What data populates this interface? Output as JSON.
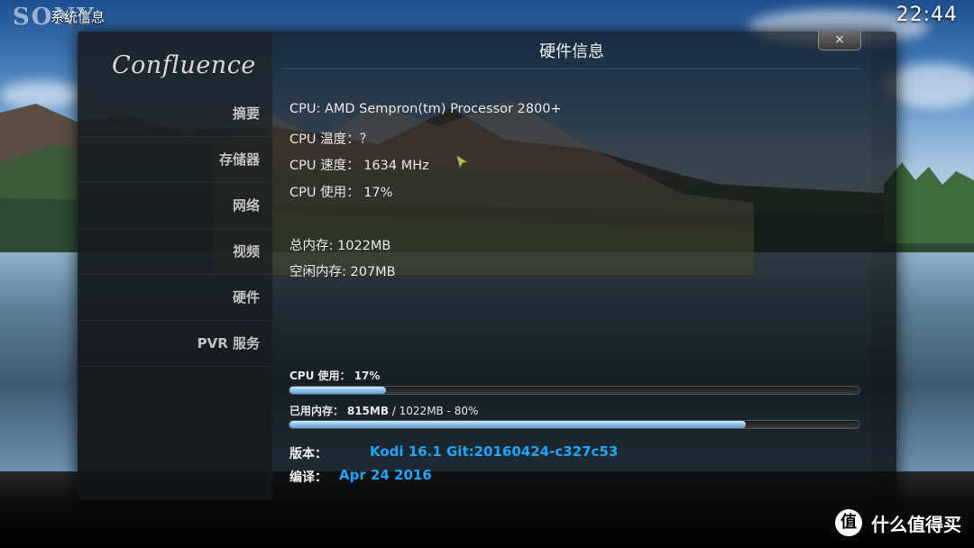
{
  "top": {
    "brand_logo": "SONY",
    "title": "系统信息",
    "clock": "22:44"
  },
  "dialog": {
    "title": "硬件信息",
    "close_label": "×",
    "logo_text": "Confluence"
  },
  "sidebar": {
    "items": [
      {
        "label": "摘要"
      },
      {
        "label": "存储器"
      },
      {
        "label": "网络"
      },
      {
        "label": "视频"
      },
      {
        "label": "硬件"
      },
      {
        "label": "PVR 服务"
      }
    ]
  },
  "info": {
    "cpu_model": "CPU: AMD Sempron(tm) Processor 2800+",
    "cpu_temp": "CPU 温度：？",
    "cpu_speed": "CPU 速度： 1634 MHz",
    "cpu_usage": "CPU 使用： 17%",
    "mem_total": "总内存: 1022MB",
    "mem_free": "空闲内存: 207MB"
  },
  "bars": {
    "cpu": {
      "label": "CPU 使用： 17%",
      "percent": 17
    },
    "mem": {
      "label_key": "已用内存：",
      "label_used": "815MB",
      "label_rest": " / 1022MB - 80%",
      "percent": 80
    }
  },
  "version": {
    "key": "版本：",
    "value": "Kodi 16.1 Git:20160424-c327c53",
    "build_key": "编译：",
    "build_value": "Apr 24 2016"
  },
  "watermark": {
    "icon": "值",
    "text": "什么值得买"
  },
  "colors": {
    "accent_blue": "#1ea6ff",
    "bar_fill": "#8ec1ea"
  }
}
